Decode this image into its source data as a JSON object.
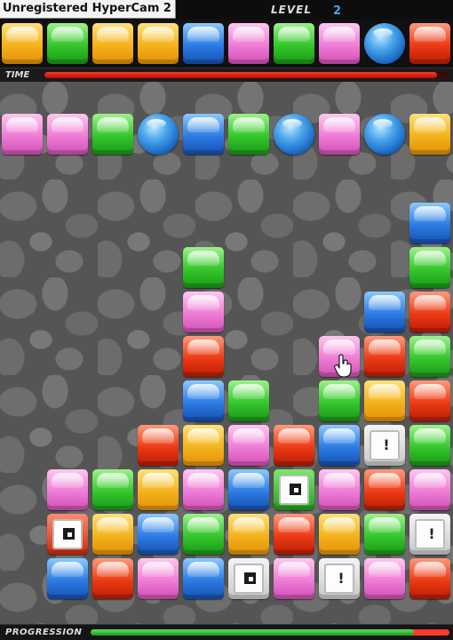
{
  "watermark": "Unregistered HyperCam 2",
  "header": {
    "level_label": "LEVEL",
    "level_value": "2"
  },
  "time_bar": {
    "label": "TIME",
    "fraction_remaining": 0.97,
    "color": "#e8261a"
  },
  "progression_bar": {
    "label": "PROGRESSION",
    "fraction": 0.9,
    "fill_color": "#3bbf2e",
    "track_color": "#ff3a2a"
  },
  "colors": {
    "yellow": "#f4b21c",
    "green": "#34c62b",
    "blue": "#2b7be3",
    "pink": "#ef7cd6",
    "red": "#ec3a14",
    "orb": "#4aa6ec"
  },
  "next_row": [
    "yellow",
    "green",
    "yellow",
    "yellow",
    "blue",
    "pink",
    "green",
    "pink",
    "orb",
    "red"
  ],
  "board": {
    "columns": 10,
    "rows": 12,
    "cells": [
      [
        "pink",
        "pink",
        "green",
        "orb",
        "blue",
        "green",
        "orb",
        "pink",
        "orb",
        "yellow"
      ],
      [
        null,
        null,
        null,
        null,
        null,
        null,
        null,
        null,
        null,
        null
      ],
      [
        null,
        null,
        null,
        null,
        null,
        null,
        null,
        null,
        null,
        "blue"
      ],
      [
        null,
        null,
        null,
        null,
        "green",
        null,
        null,
        null,
        null,
        "green"
      ],
      [
        null,
        null,
        null,
        null,
        "pink",
        null,
        null,
        null,
        "blue",
        "red"
      ],
      [
        null,
        null,
        null,
        null,
        "red",
        null,
        null,
        "pink",
        "red",
        "green"
      ],
      [
        null,
        null,
        null,
        null,
        "blue",
        "green",
        null,
        "green",
        "yellow",
        "red"
      ],
      [
        null,
        null,
        null,
        "red",
        "yellow",
        "pink",
        "red",
        "blue",
        "special-white-alert",
        "green"
      ],
      [
        null,
        "pink",
        "green",
        "yellow",
        "pink",
        "blue",
        "special-green-stop",
        "pink",
        "red",
        "pink"
      ],
      [
        null,
        "special-red-stop",
        "yellow",
        "blue",
        "green",
        "yellow",
        "red",
        "yellow",
        "green",
        "special-white-alert"
      ],
      [
        null,
        "blue",
        "red",
        "pink",
        "blue",
        "special-white-stop",
        "pink",
        "special-white-alert",
        "pink",
        "red"
      ]
    ]
  },
  "cursor": {
    "icon": "hand-pointer-icon",
    "over_cell": [
      5,
      7
    ]
  }
}
